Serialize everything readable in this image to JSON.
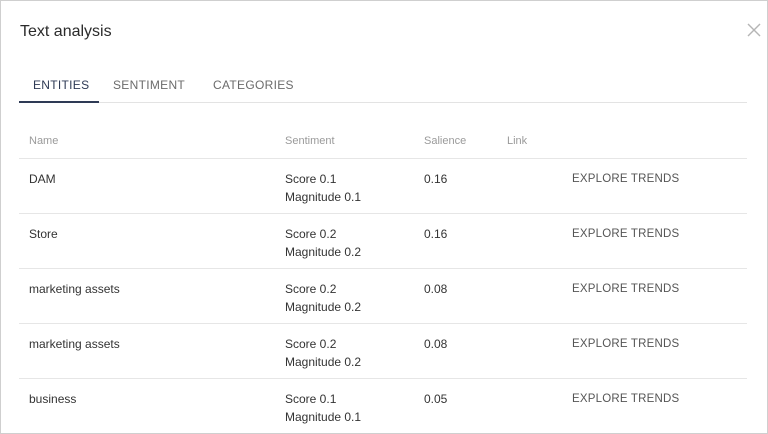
{
  "dialog": {
    "title": "Text analysis"
  },
  "tabs": [
    {
      "label": "ENTITIES",
      "active": true
    },
    {
      "label": "SENTIMENT",
      "active": false
    },
    {
      "label": "CATEGORIES",
      "active": false
    }
  ],
  "table": {
    "headers": {
      "name": "Name",
      "sentiment": "Sentiment",
      "salience": "Salience",
      "link": "Link"
    },
    "rows": [
      {
        "name": "DAM",
        "score": "Score 0.1",
        "magnitude": "Magnitude 0.1",
        "salience": "0.16",
        "action": "EXPLORE TRENDS"
      },
      {
        "name": "Store",
        "score": "Score 0.2",
        "magnitude": "Magnitude 0.2",
        "salience": "0.16",
        "action": "EXPLORE TRENDS"
      },
      {
        "name": "marketing assets",
        "score": "Score 0.2",
        "magnitude": "Magnitude 0.2",
        "salience": "0.08",
        "action": "EXPLORE TRENDS"
      },
      {
        "name": "marketing assets",
        "score": "Score 0.2",
        "magnitude": "Magnitude 0.2",
        "salience": "0.08",
        "action": "EXPLORE TRENDS"
      },
      {
        "name": "business",
        "score": "Score 0.1",
        "magnitude": "Magnitude 0.1",
        "salience": "0.05",
        "action": "EXPLORE TRENDS"
      }
    ]
  },
  "icons": {
    "close": "close-icon"
  },
  "colors": {
    "active_tab": "#2e3a55",
    "border": "#e6e6e6"
  }
}
